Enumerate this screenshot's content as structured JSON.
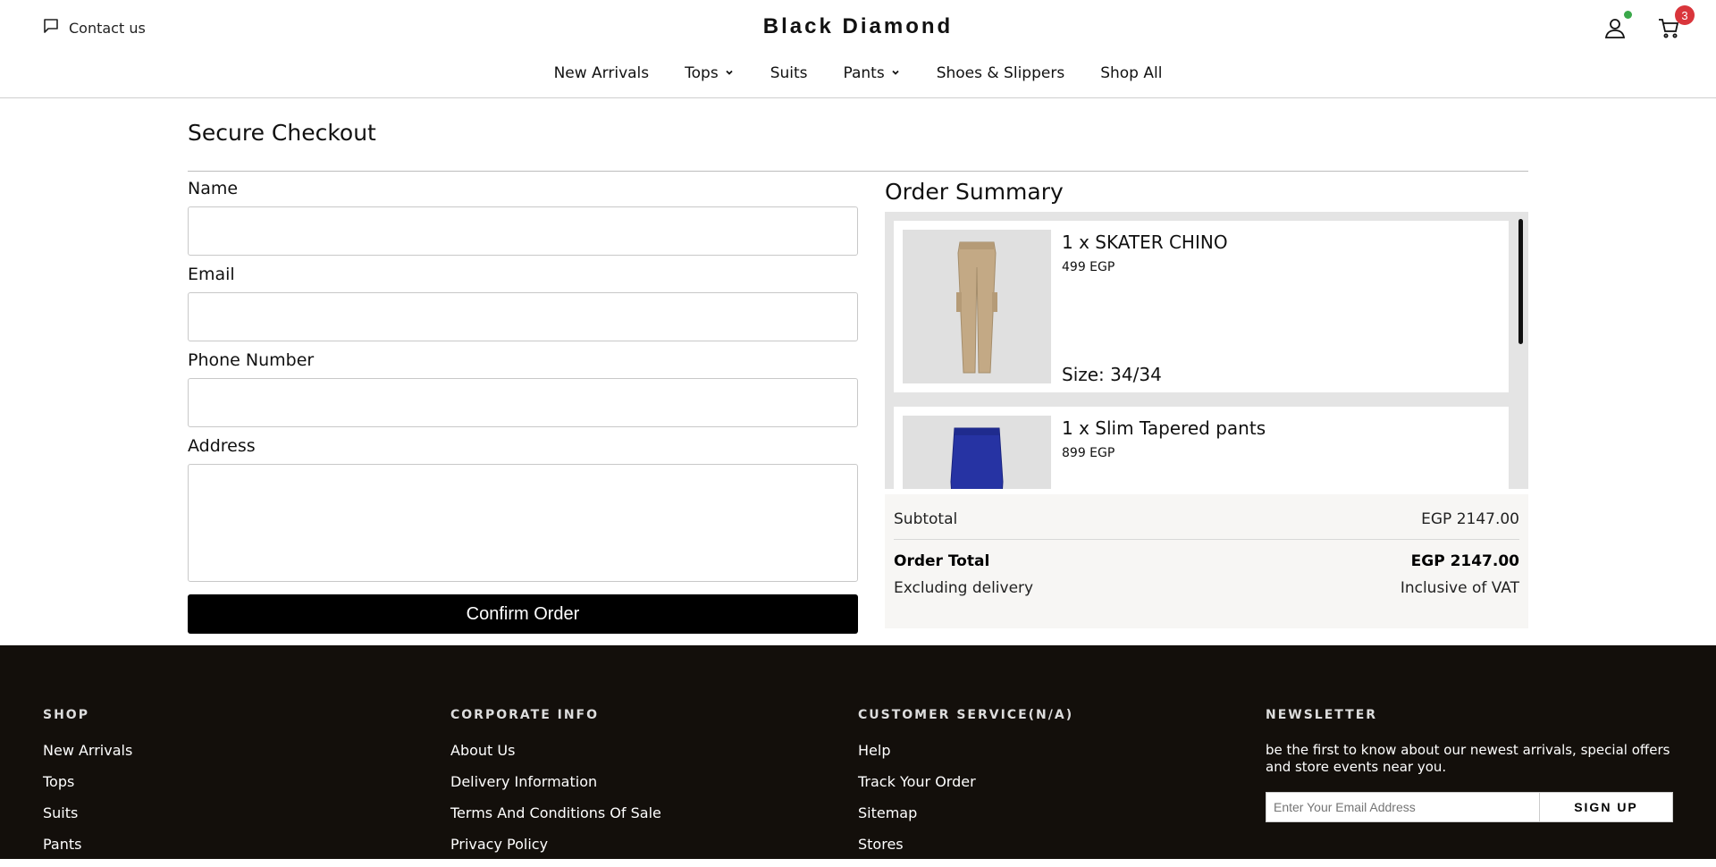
{
  "header": {
    "contact_label": "Contact us",
    "brand": "Black Diamond",
    "cart_count": "3",
    "nav": [
      {
        "label": "New Arrivals"
      },
      {
        "label": "Tops"
      },
      {
        "label": "Suits"
      },
      {
        "label": "Pants"
      },
      {
        "label": "Shoes & Slippers"
      },
      {
        "label": "Shop All"
      }
    ]
  },
  "checkout": {
    "title": "Secure Checkout",
    "fields": {
      "name_label": "Name",
      "email_label": "Email",
      "phone_label": "Phone Number",
      "address_label": "Address",
      "name_value": "",
      "email_value": "",
      "phone_value": "",
      "address_value": ""
    },
    "confirm_label": "Confirm Order"
  },
  "summary": {
    "title": "Order Summary",
    "items": [
      {
        "name": "1 x SKATER CHINO",
        "price": "499 EGP",
        "size": "Size: 34/34"
      },
      {
        "name": "1 x Slim Tapered pants",
        "price": "899 EGP",
        "size": ""
      }
    ],
    "subtotal_label": "Subtotal",
    "subtotal_value": "EGP 2147.00",
    "total_label": "Order Total",
    "total_value": "EGP 2147.00",
    "delivery_note": "Excluding delivery",
    "vat_note": "Inclusive of VAT"
  },
  "footer": {
    "shop": {
      "title": "SHOP",
      "links": [
        "New Arrivals",
        "Tops",
        "Suits",
        "Pants"
      ]
    },
    "corporate": {
      "title": "CORPORATE INFO",
      "links": [
        "About Us",
        "Delivery Information",
        "Terms And Conditions Of Sale",
        "Privacy Policy"
      ]
    },
    "service": {
      "title": "CUSTOMER SERVICE(N/A)",
      "links": [
        "Help",
        "Track Your Order",
        "Sitemap",
        "Stores"
      ]
    },
    "newsletter": {
      "title": "NEWSLETTER",
      "text": "be the first to know about our newest arrivals, special offers and store events near you.",
      "placeholder": "Enter Your Email Address",
      "button": "SIGN UP"
    }
  },
  "colors": {
    "badge": "#d9353b",
    "online_dot": "#3aa84a",
    "footer_bg": "#130f0b"
  }
}
